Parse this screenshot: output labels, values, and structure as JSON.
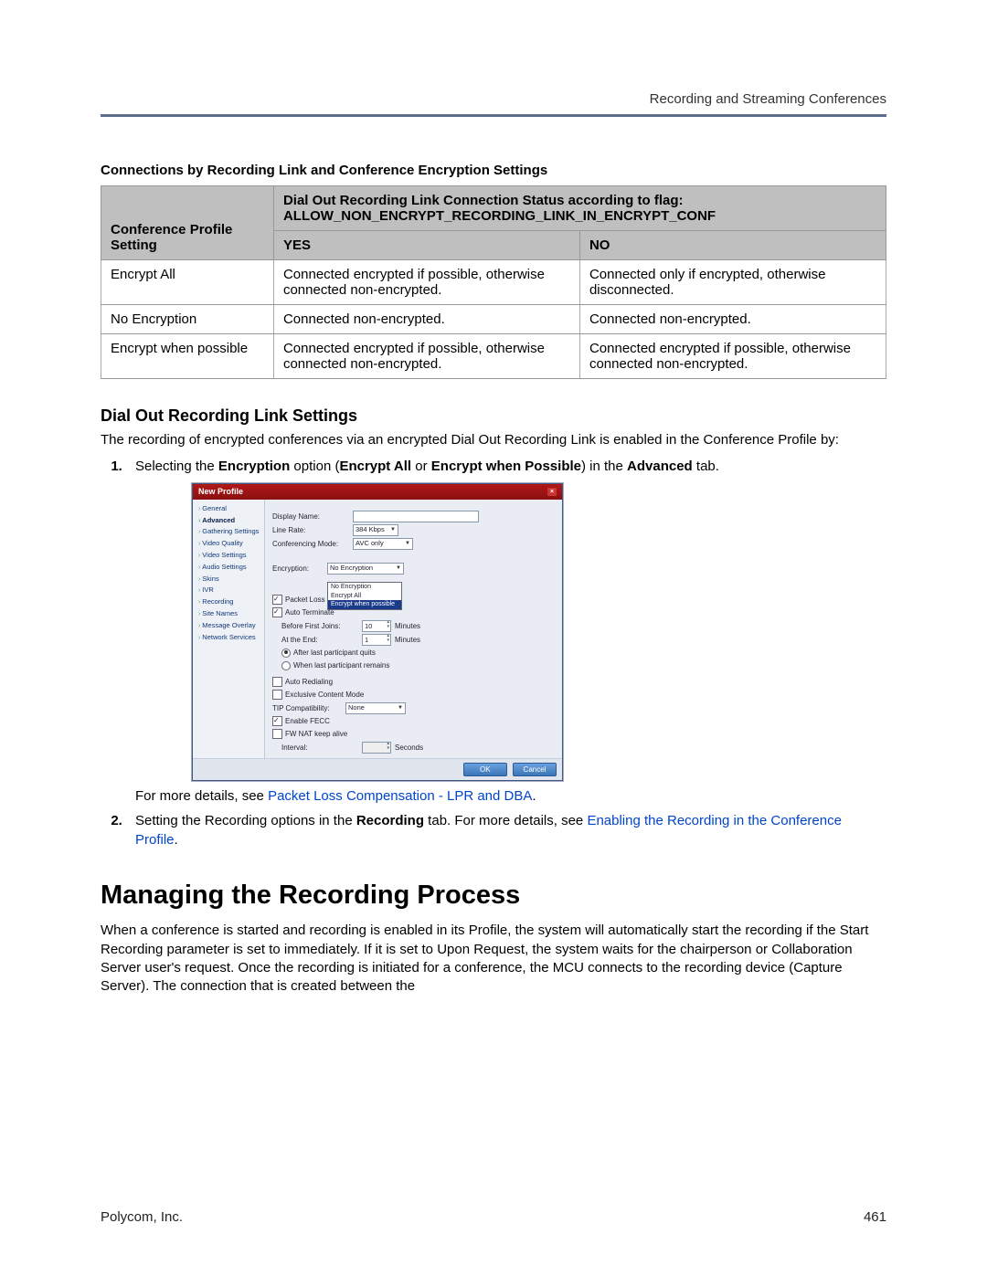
{
  "header": {
    "running": "Recording and Streaming Conferences"
  },
  "table": {
    "title": "Connections by Recording Link and Conference Encryption Settings",
    "head_span": "Dial Out Recording Link Connection Status according to flag: ALLOW_NON_ENCRYPT_RECORDING_LINK_IN_ENCRYPT_CONF",
    "col0": "Conference Profile Setting",
    "col1": "YES",
    "col2": "NO",
    "rows": [
      {
        "c0": "Encrypt All",
        "c1": "Connected encrypted if possible, otherwise connected non-encrypted.",
        "c2": "Connected only if encrypted, otherwise disconnected."
      },
      {
        "c0": "No Encryption",
        "c1": "Connected non-encrypted.",
        "c2": "Connected non-encrypted."
      },
      {
        "c0": "Encrypt when possible",
        "c1": "Connected encrypted if possible, otherwise connected non-encrypted.",
        "c2": "Connected encrypted if possible, otherwise connected non-encrypted."
      }
    ]
  },
  "subhead": "Dial Out Recording Link Settings",
  "para1": "The recording of encrypted conferences via an encrypted Dial Out Recording Link is enabled in the Conference Profile by:",
  "step1": {
    "pre": "Selecting the ",
    "b1": "Encryption",
    "mid1": " option (",
    "b2": "Encrypt All",
    "mid2": " or ",
    "b3": "Encrypt when Possible",
    "mid3": ") in the ",
    "b4": "Advanced",
    "post": " tab."
  },
  "moredetails1_pre": "For more details, see ",
  "moredetails1_link": "Packet Loss Compensation - LPR and DBA",
  "moredetails1_post": ".",
  "step2": {
    "t1": "Setting the Recording options in the ",
    "b1": "Recording",
    "t2": " tab. For more details, see ",
    "link": "Enabling the Recording in the Conference Profile",
    "t3": "."
  },
  "h1": "Managing the Recording Process",
  "para2": "When a conference is started and recording is enabled in its Profile, the system will automatically start the recording if the Start Recording parameter is set to immediately. If it is set to Upon Request, the system waits for the chairperson or Collaboration Server user's request. Once the recording is initiated for a conference, the MCU connects to the recording device (Capture Server). The connection that is created between the",
  "footer": {
    "left": "Polycom, Inc.",
    "right": "461"
  },
  "dialog": {
    "title": "New Profile",
    "nav": [
      "General",
      "Advanced",
      "Gathering Settings",
      "Video Quality",
      "Video Settings",
      "Audio Settings",
      "Skins",
      "IVR",
      "Recording",
      "Site Names",
      "Message Overlay",
      "Network Services"
    ],
    "labels": {
      "display_name": "Display Name:",
      "line_rate": "Line Rate:",
      "line_rate_val": "384 Kbps",
      "conf_mode": "Conferencing Mode:",
      "conf_mode_val": "AVC only",
      "encryption": "Encryption:",
      "enc_sel": "No Encryption",
      "enc_opts": [
        "No Encryption",
        "Encrypt All",
        "Encrypt when possible"
      ],
      "plc": "Packet Loss Compensation:",
      "auto_term": "Auto Terminate",
      "before_join": "Before First Joins:",
      "before_join_val": "10",
      "at_end": "At the End:",
      "at_end_val": "1",
      "minutes": "Minutes",
      "after_last": "After last participant quits",
      "when_last": "When last participant remains",
      "auto_redial": "Auto Redialing",
      "exclusive": "Exclusive Content Mode",
      "tip": "TIP Compatibility:",
      "tip_val": "None",
      "fecc": "Enable FECC",
      "nat": "FW NAT keep alive",
      "interval": "Interval:",
      "seconds": "Seconds"
    },
    "buttons": {
      "ok": "OK",
      "cancel": "Cancel"
    }
  }
}
